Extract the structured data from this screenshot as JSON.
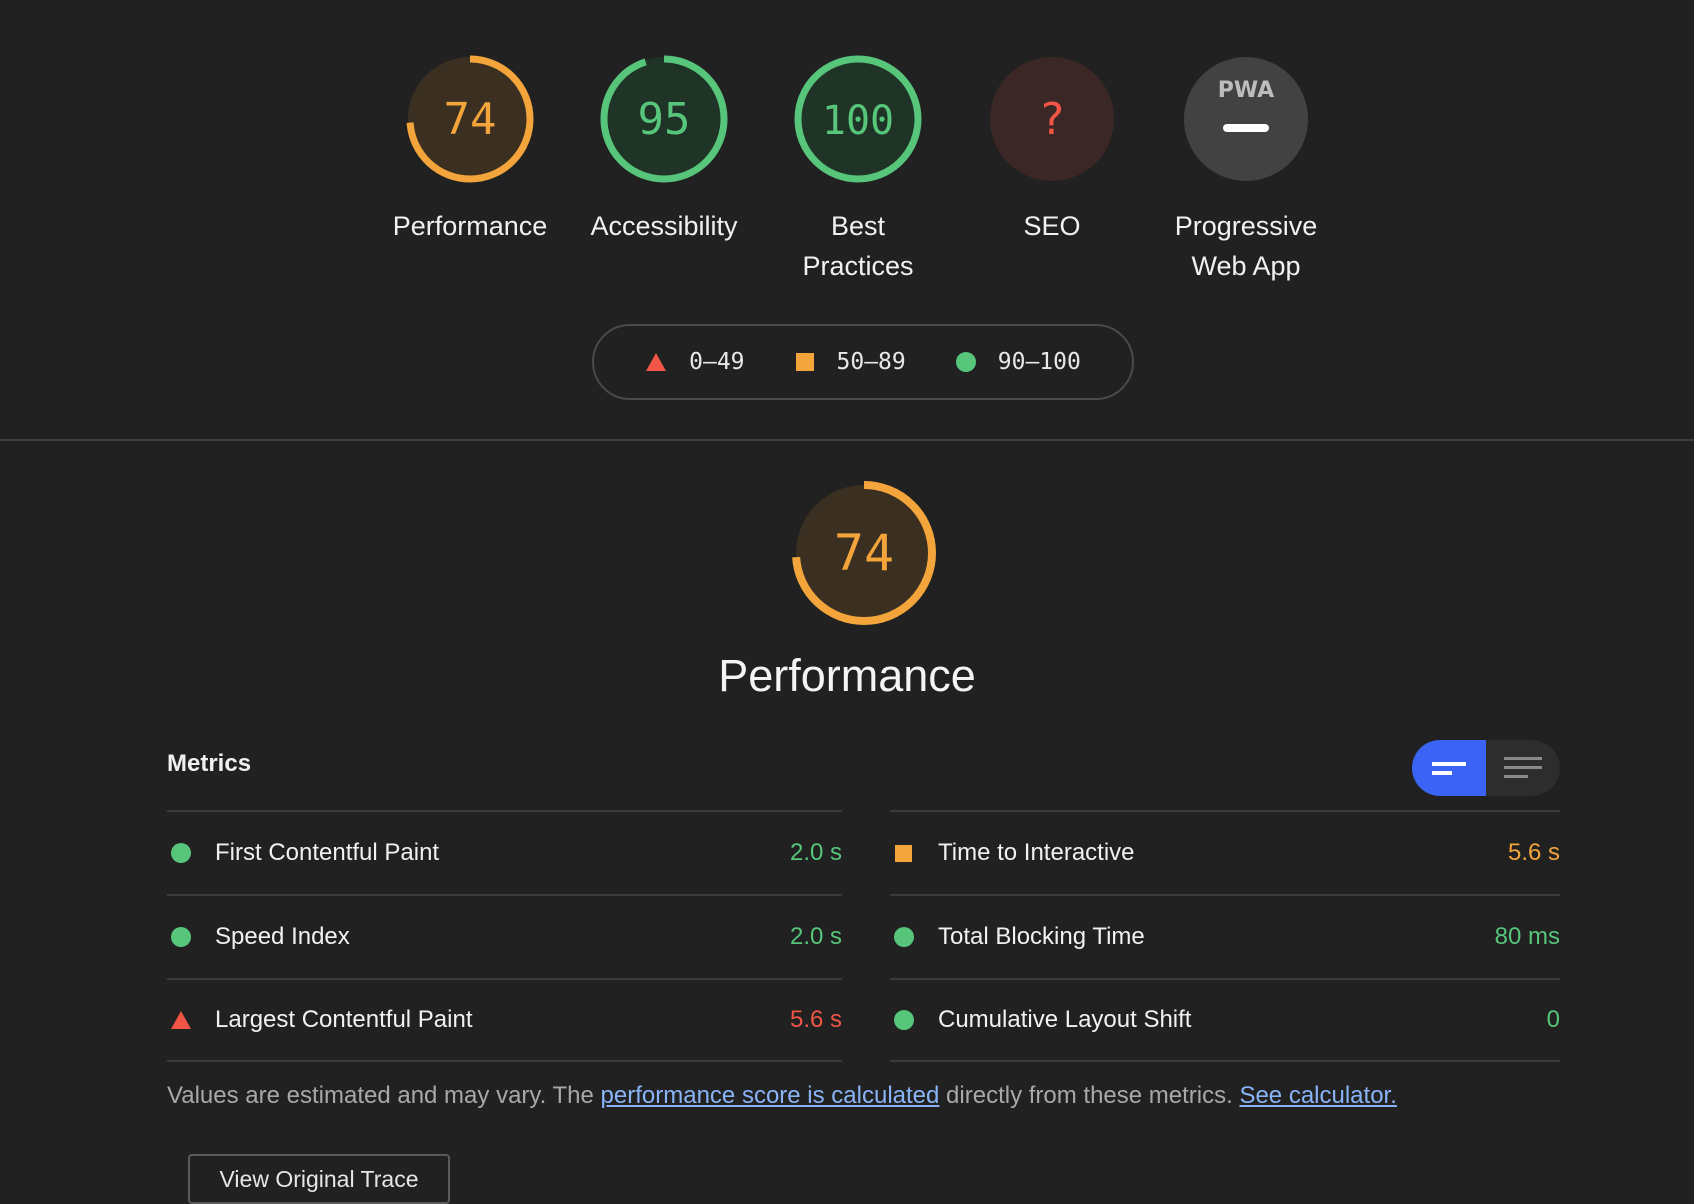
{
  "colors": {
    "fail": "#f05545",
    "average": "#f3a43b",
    "pass": "#57c57a",
    "accent": "#3c64f4",
    "link": "#8ab4f8"
  },
  "gauges": [
    {
      "score": "74",
      "label_line1": "Performance",
      "label_line2": "",
      "status": "average",
      "fraction": 0.74
    },
    {
      "score": "95",
      "label_line1": "Accessibility",
      "label_line2": "",
      "status": "pass",
      "fraction": 0.95
    },
    {
      "score": "100",
      "label_line1": "Best",
      "label_line2": "Practices",
      "status": "pass",
      "fraction": 1.0
    },
    {
      "score": "?",
      "label_line1": "SEO",
      "label_line2": "",
      "status": "fail",
      "fraction": 0
    },
    {
      "score": "",
      "label_line1": "Progressive",
      "label_line2": "Web App",
      "status": "pwa",
      "badge": "PWA",
      "fraction": 0
    }
  ],
  "legend": [
    {
      "icon": "triangle-icon",
      "range": "0–49"
    },
    {
      "icon": "square-icon",
      "range": "50–89"
    },
    {
      "icon": "circle-icon",
      "range": "90–100"
    }
  ],
  "performance": {
    "score": "74",
    "fraction": 0.74,
    "title": "Performance"
  },
  "metrics": {
    "header": "Metrics",
    "left": [
      {
        "name": "First Contentful Paint",
        "value": "2.0 s",
        "status": "pass"
      },
      {
        "name": "Speed Index",
        "value": "2.0 s",
        "status": "pass"
      },
      {
        "name": "Largest Contentful Paint",
        "value": "5.6 s",
        "status": "fail"
      }
    ],
    "right": [
      {
        "name": "Time to Interactive",
        "value": "5.6 s",
        "status": "average"
      },
      {
        "name": "Total Blocking Time",
        "value": "80 ms",
        "status": "pass"
      },
      {
        "name": "Cumulative Layout Shift",
        "value": "0",
        "status": "pass"
      }
    ]
  },
  "footnote": {
    "prefix": "Values are estimated and may vary. The ",
    "link1": "performance score is calculated",
    "middle": " directly from these metrics. ",
    "link2": "See calculator."
  },
  "trace_button": "View Original Trace"
}
